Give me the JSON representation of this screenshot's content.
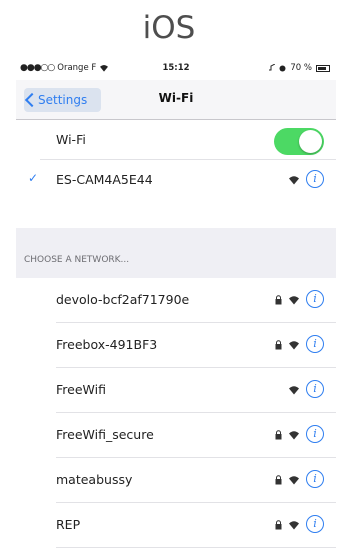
{
  "heading": "iOS",
  "status": {
    "carrier": "Orange F",
    "time": "15:12",
    "battery": "70 %",
    "signal_dots": "●●●○○"
  },
  "nav": {
    "back": "Settings",
    "title": "Wi-Fi"
  },
  "wifi_toggle": {
    "label": "Wi-Fi",
    "on": true
  },
  "connected": {
    "name": "ES-CAM4A5E44",
    "check": "✓"
  },
  "section_header": "CHOOSE A NETWORK...",
  "networks": [
    {
      "name": "devolo-bcf2af71790e",
      "locked": true
    },
    {
      "name": "Freebox-491BF3",
      "locked": true
    },
    {
      "name": "FreeWifi",
      "locked": false
    },
    {
      "name": "FreeWifi_secure",
      "locked": true
    },
    {
      "name": "mateabussy",
      "locked": true
    },
    {
      "name": "REP",
      "locked": true
    }
  ],
  "colors": {
    "accent": "#2f7ef0",
    "toggle_on": "#4cd964",
    "section_bg": "#efeff4"
  },
  "icons": {
    "info": "info-icon",
    "wifi": "wifi-icon",
    "lock": "lock-icon",
    "check": "checkmark-icon"
  },
  "info_glyph": "i"
}
